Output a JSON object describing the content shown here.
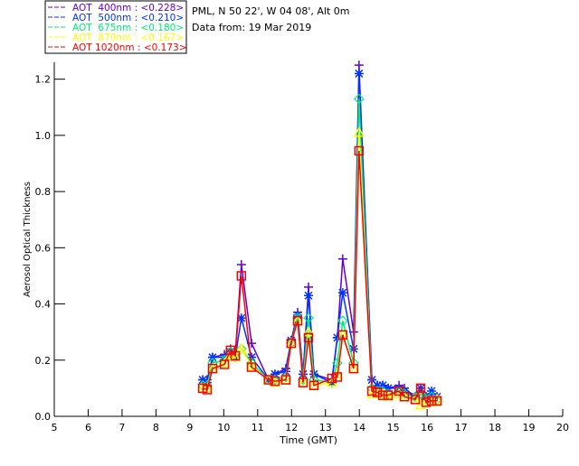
{
  "header": {
    "site": "PML, N 50 22', W 04 08', Alt 0m",
    "date": "Data from: 19 Mar 2019"
  },
  "chart_data": {
    "type": "line",
    "title": "",
    "xlabel": "Time (GMT)",
    "ylabel": "Aerosol Optical Thickness",
    "xlim": [
      5,
      20
    ],
    "ylim": [
      0,
      1.26
    ],
    "xticks": [
      5,
      6,
      7,
      8,
      9,
      10,
      11,
      12,
      13,
      14,
      15,
      16,
      17,
      18,
      19,
      20
    ],
    "yticks": [
      "0.0",
      "0.2",
      "0.4",
      "0.6",
      "0.8",
      "1.0",
      "1.2"
    ],
    "grid": false,
    "legend_position": "top-left",
    "x": [
      9.38,
      9.51,
      9.67,
      10.02,
      10.2,
      10.34,
      10.52,
      10.82,
      11.32,
      11.51,
      11.83,
      11.99,
      12.18,
      12.34,
      12.5,
      12.66,
      13.19,
      13.35,
      13.51,
      13.83,
      13.99,
      14.37,
      14.53,
      14.69,
      14.85,
      15.17,
      15.33,
      15.65,
      15.81,
      15.97,
      16.13,
      16.29
    ],
    "series": [
      {
        "name": "AOT  400nm : <0.228>",
        "color": "#6600cc",
        "marker": "plus",
        "values": [
          0.13,
          0.13,
          0.21,
          0.22,
          0.24,
          0.22,
          0.54,
          0.26,
          0.13,
          0.15,
          0.17,
          0.27,
          0.37,
          0.15,
          0.46,
          0.15,
          0.13,
          0.28,
          0.56,
          0.3,
          1.25,
          0.13,
          0.11,
          0.11,
          0.1,
          0.11,
          0.1,
          0.07,
          0.1,
          0.07,
          0.08,
          0.07
        ]
      },
      {
        "name": "AOT  500nm : <0.210>",
        "color": "#0033ff",
        "marker": "asterisk",
        "values": [
          0.13,
          0.12,
          0.21,
          0.21,
          0.22,
          0.21,
          0.35,
          0.21,
          0.13,
          0.15,
          0.16,
          0.27,
          0.36,
          0.15,
          0.43,
          0.15,
          0.12,
          0.28,
          0.44,
          0.24,
          1.22,
          0.13,
          0.11,
          0.11,
          0.1,
          0.1,
          0.09,
          0.07,
          0.1,
          0.07,
          0.09,
          0.07
        ]
      },
      {
        "name": "AOT  675nm : <0.180>",
        "color": "#00ee77",
        "marker": "diamond",
        "values": [
          0.11,
          0.11,
          0.19,
          0.2,
          0.23,
          0.21,
          0.24,
          0.19,
          0.13,
          0.13,
          0.14,
          0.26,
          0.35,
          0.13,
          0.35,
          0.13,
          0.12,
          0.19,
          0.34,
          0.19,
          1.13,
          0.1,
          0.09,
          0.09,
          0.08,
          0.09,
          0.08,
          0.07,
          0.08,
          0.06,
          0.07,
          0.06
        ]
      },
      {
        "name": "AOT  870nm : <0.167>",
        "color": "#ffff00",
        "marker": "triangle",
        "values": [
          0.1,
          0.1,
          0.17,
          0.19,
          0.22,
          0.21,
          0.24,
          0.18,
          0.13,
          0.12,
          0.13,
          0.26,
          0.34,
          0.12,
          0.3,
          0.11,
          0.12,
          0.15,
          0.29,
          0.17,
          1.01,
          0.08,
          0.08,
          0.08,
          0.07,
          0.08,
          0.07,
          0.06,
          0.04,
          0.05,
          0.05,
          0.06
        ]
      },
      {
        "name": "AOT 1020nm : <0.173>",
        "color": "#ff0000",
        "marker": "square",
        "values": [
          0.1,
          0.095,
          0.17,
          0.185,
          0.235,
          0.215,
          0.5,
          0.175,
          0.13,
          0.125,
          0.13,
          0.26,
          0.34,
          0.12,
          0.28,
          0.11,
          0.135,
          0.14,
          0.29,
          0.17,
          0.945,
          0.09,
          0.085,
          0.075,
          0.075,
          0.09,
          0.07,
          0.06,
          0.1,
          0.05,
          0.055,
          0.055
        ]
      }
    ]
  }
}
